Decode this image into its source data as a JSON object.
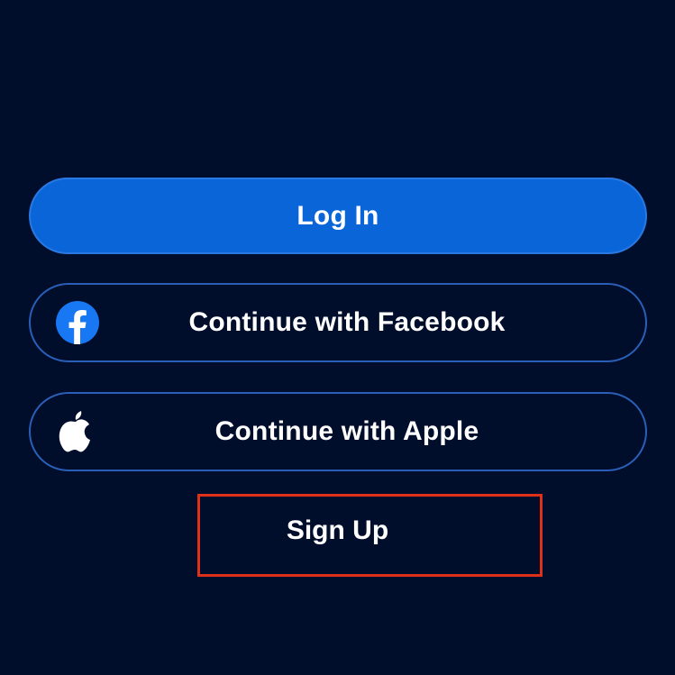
{
  "auth": {
    "login_label": "Log In",
    "facebook_label": "Continue with Facebook",
    "apple_label": "Continue with Apple",
    "signup_label": "Sign Up"
  },
  "icons": {
    "facebook": "facebook-icon",
    "apple": "apple-icon"
  },
  "colors": {
    "background": "#000d2b",
    "primary": "#0a66d8",
    "outline": "#2a5fb8",
    "facebook": "#1877f2",
    "highlight": "#e0301a"
  }
}
